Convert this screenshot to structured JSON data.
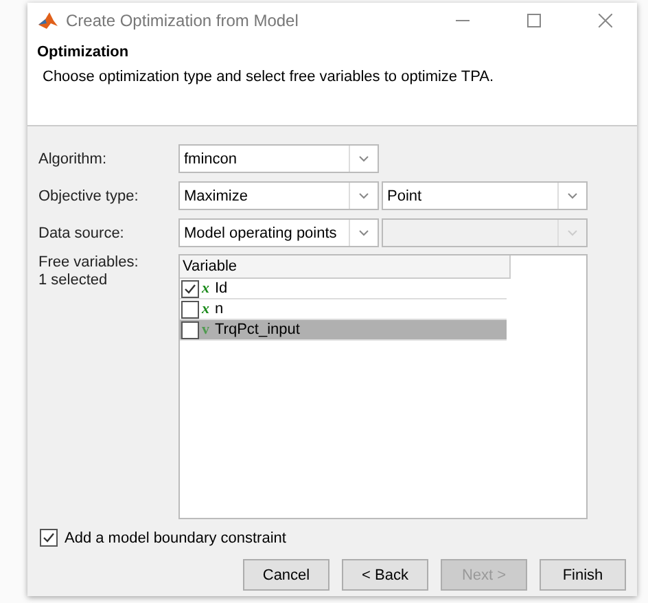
{
  "window": {
    "title": "Create Optimization from Model"
  },
  "header": {
    "title": "Optimization",
    "description": "Choose optimization type and select free variables to optimize TPA."
  },
  "fields": [
    {
      "label": "Algorithm:",
      "selects": [
        {
          "value": "fmincon",
          "disabled": false
        }
      ]
    },
    {
      "label": "Objective type:",
      "selects": [
        {
          "value": "Maximize",
          "disabled": false
        },
        {
          "value": "Point",
          "disabled": false
        }
      ]
    },
    {
      "label": "Data source:",
      "selects": [
        {
          "value": "Model operating points",
          "disabled": false
        },
        {
          "disabled": true
        }
      ]
    }
  ],
  "free_variables": {
    "label": "Free variables:",
    "count": "1 selected",
    "column": "Variable",
    "rows": [
      {
        "symbol": "x",
        "name": "Id",
        "checked": true,
        "selected": false,
        "dim": false
      },
      {
        "symbol": "x",
        "name": "n",
        "checked": false,
        "selected": false,
        "dim": false
      },
      {
        "symbol": "v",
        "name": "TrqPct_input",
        "checked": false,
        "selected": true,
        "dim": true
      }
    ]
  },
  "boundary": {
    "label": "Add a model boundary constraint",
    "checked": true
  },
  "buttons": [
    {
      "label": "Cancel",
      "disabled": false
    },
    {
      "label": "< Back",
      "disabled": false
    },
    {
      "label": "Next >",
      "disabled": true
    },
    {
      "label": "Finish",
      "disabled": false
    }
  ]
}
